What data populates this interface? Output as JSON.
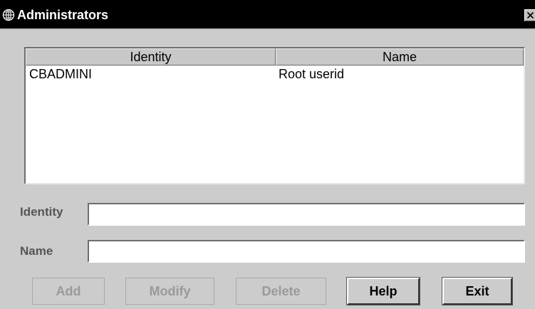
{
  "window": {
    "title": "Administrators",
    "close_icon": "close-icon"
  },
  "table": {
    "columns": [
      "Identity",
      "Name"
    ],
    "rows": [
      {
        "identity": "CBADMINI",
        "name": "Root userid"
      }
    ]
  },
  "form": {
    "identity_label": "Identity",
    "identity_value": "",
    "name_label": "Name",
    "name_value": ""
  },
  "buttons": {
    "add": "Add",
    "modify": "Modify",
    "delete": "Delete",
    "help": "Help",
    "exit": "Exit"
  },
  "colors": {
    "titlebar": "#000000",
    "title_text": "#ffffff",
    "window_bg": "#cccccc",
    "disabled_text": "#9a9a9a"
  }
}
